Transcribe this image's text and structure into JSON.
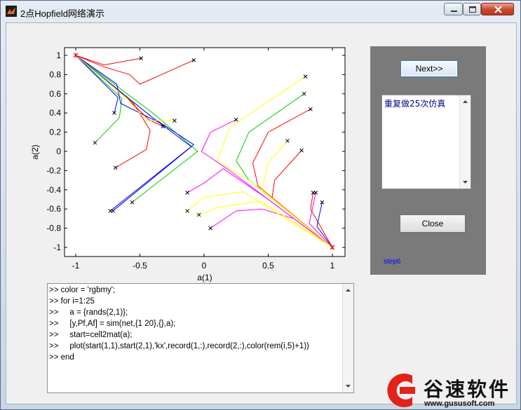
{
  "window": {
    "title": "2点Hopfield网络演示",
    "icon": "matlab-logo-icon",
    "controls": {
      "minimize": "minimize-icon",
      "maximize": "maximize-icon",
      "close": "close-icon"
    }
  },
  "axes": {
    "xlabel": "a(1)",
    "ylabel": "a(2)",
    "xlim": [
      -1.1,
      1.1
    ],
    "ylim": [
      -1.1,
      1.1
    ],
    "xticks": [
      "-1",
      "-0.5",
      "0",
      "0.5",
      "1"
    ],
    "yticks": [
      "1",
      "0.8",
      "0.6",
      "0.4",
      "0.2",
      "0",
      "-0.2",
      "-0.4",
      "-0.6",
      "-0.8",
      "-1"
    ],
    "series_colors": {
      "r": "#ff0000",
      "g": "#00cc00",
      "b": "#0000ff",
      "m": "#ff00ff",
      "y": "#ffff00"
    }
  },
  "chart_data": {
    "type": "line",
    "xlabel": "a(1)",
    "ylabel": "a(2)",
    "xlim": [
      -1.1,
      1.1
    ],
    "ylim": [
      -1.1,
      1.1
    ],
    "grid": false,
    "attractors": [
      [
        -1,
        1
      ],
      [
        1,
        -1
      ]
    ],
    "series": [
      {
        "color": "r",
        "start": [
          -0.08,
          0.95
        ],
        "points": [
          [
            -0.08,
            0.95
          ],
          [
            -0.5,
            0.7
          ],
          [
            -0.58,
            0.8
          ],
          [
            -0.78,
            0.88
          ],
          [
            -1,
            1
          ]
        ]
      },
      {
        "color": "r",
        "start": [
          -0.49,
          0.97
        ],
        "points": [
          [
            -0.49,
            0.97
          ],
          [
            -0.78,
            0.9
          ],
          [
            -1,
            1
          ]
        ]
      },
      {
        "color": "r",
        "start": [
          -0.69,
          -0.17
        ],
        "points": [
          [
            -0.69,
            -0.17
          ],
          [
            -0.45,
            0.02
          ],
          [
            -0.42,
            0.22
          ],
          [
            -0.55,
            0.5
          ],
          [
            -1,
            1
          ]
        ]
      },
      {
        "color": "r",
        "start": [
          -0.32,
          0.26
        ],
        "points": [
          [
            -0.32,
            0.26
          ],
          [
            -0.43,
            0.33
          ],
          [
            -0.6,
            0.55
          ],
          [
            -1,
            1
          ]
        ]
      },
      {
        "color": "r",
        "start": [
          0.83,
          0.44
        ],
        "points": [
          [
            0.83,
            0.44
          ],
          [
            0.5,
            0.2
          ],
          [
            0.38,
            -0.12
          ],
          [
            0.42,
            -0.36
          ],
          [
            1,
            -1
          ]
        ]
      },
      {
        "color": "r",
        "start": [
          0.76,
          0.01
        ],
        "points": [
          [
            0.76,
            0.01
          ],
          [
            0.55,
            -0.3
          ],
          [
            0.53,
            -0.48
          ],
          [
            1,
            -1
          ]
        ]
      },
      {
        "color": "r",
        "start": [
          0.85,
          -0.43
        ],
        "points": [
          [
            0.85,
            -0.43
          ],
          [
            0.83,
            -0.6
          ],
          [
            1,
            -1
          ]
        ]
      },
      {
        "color": "g",
        "start": [
          -0.85,
          0.09
        ],
        "points": [
          [
            -0.85,
            0.09
          ],
          [
            -0.66,
            0.35
          ],
          [
            -0.64,
            0.55
          ],
          [
            -1,
            1
          ]
        ]
      },
      {
        "color": "g",
        "start": [
          -0.56,
          -0.53
        ],
        "points": [
          [
            -0.56,
            -0.53
          ],
          [
            -0.05,
            0.0
          ],
          [
            -0.4,
            0.4
          ],
          [
            -1,
            1
          ]
        ]
      },
      {
        "color": "g",
        "start": [
          0.78,
          0.6
        ],
        "points": [
          [
            0.78,
            0.6
          ],
          [
            0.35,
            0.2
          ],
          [
            0.25,
            -0.1
          ],
          [
            0.35,
            -0.3
          ],
          [
            1,
            -1
          ]
        ]
      },
      {
        "color": "b",
        "start": [
          -0.73,
          -0.62
        ],
        "points": [
          [
            -0.73,
            -0.62
          ],
          [
            -0.1,
            0.05
          ],
          [
            -0.35,
            0.3
          ],
          [
            -0.65,
            0.5
          ],
          [
            -0.68,
            0.7
          ],
          [
            -1,
            1
          ]
        ]
      },
      {
        "color": "b",
        "start": [
          -0.71,
          -0.62
        ],
        "points": [
          [
            -0.71,
            -0.62
          ],
          [
            -0.08,
            0.07
          ],
          [
            -0.4,
            0.35
          ],
          [
            -1,
            1
          ]
        ]
      },
      {
        "color": "b",
        "start": [
          0.92,
          -0.53
        ],
        "points": [
          [
            0.92,
            -0.53
          ],
          [
            0.88,
            -0.78
          ],
          [
            1,
            -1
          ]
        ]
      },
      {
        "color": "b",
        "start": [
          -0.7,
          0.4
        ],
        "points": [
          [
            -0.7,
            0.4
          ],
          [
            -0.67,
            0.56
          ],
          [
            -1,
            1
          ]
        ]
      },
      {
        "color": "m",
        "start": [
          0.25,
          0.33
        ],
        "points": [
          [
            0.25,
            0.33
          ],
          [
            0.05,
            0.2
          ],
          [
            -0.02,
            0.0
          ],
          [
            0.2,
            -0.2
          ],
          [
            1,
            -1
          ]
        ]
      },
      {
        "color": "m",
        "start": [
          -0.13,
          -0.43
        ],
        "points": [
          [
            -0.13,
            -0.43
          ],
          [
            0.0,
            -0.33
          ],
          [
            0.15,
            -0.18
          ],
          [
            0.5,
            -0.5
          ],
          [
            1,
            -1
          ]
        ]
      },
      {
        "color": "m",
        "start": [
          0.05,
          -0.8
        ],
        "points": [
          [
            0.05,
            -0.8
          ],
          [
            0.25,
            -0.62
          ],
          [
            0.45,
            -0.6
          ],
          [
            0.7,
            -0.7
          ],
          [
            1,
            -1
          ]
        ]
      },
      {
        "color": "m",
        "start": [
          0.87,
          -0.43
        ],
        "points": [
          [
            0.87,
            -0.43
          ],
          [
            0.82,
            -0.75
          ],
          [
            1,
            -1
          ]
        ]
      },
      {
        "color": "y",
        "start": [
          0.79,
          0.78
        ],
        "points": [
          [
            0.79,
            0.78
          ],
          [
            0.2,
            0.25
          ],
          [
            0.1,
            -0.1
          ],
          [
            0.35,
            -0.3
          ],
          [
            1,
            -1
          ]
        ]
      },
      {
        "color": "y",
        "start": [
          0.65,
          0.11
        ],
        "points": [
          [
            0.65,
            0.11
          ],
          [
            0.5,
            -0.12
          ],
          [
            0.45,
            -0.4
          ],
          [
            1,
            -1
          ]
        ]
      },
      {
        "color": "y",
        "start": [
          -0.13,
          -0.62
        ],
        "points": [
          [
            -0.13,
            -0.62
          ],
          [
            0.0,
            -0.48
          ],
          [
            0.3,
            -0.42
          ],
          [
            1,
            -1
          ]
        ]
      },
      {
        "color": "y",
        "start": [
          -0.04,
          -0.66
        ],
        "points": [
          [
            -0.04,
            -0.66
          ],
          [
            0.12,
            -0.58
          ],
          [
            0.45,
            -0.52
          ],
          [
            1,
            -1
          ]
        ]
      },
      {
        "color": "y",
        "start": [
          -0.23,
          0.32
        ],
        "points": [
          [
            -0.23,
            0.32
          ],
          [
            -0.45,
            0.32
          ],
          [
            -0.6,
            0.55
          ],
          [
            -1,
            1
          ]
        ]
      }
    ]
  },
  "panel": {
    "next_label": "Next>>",
    "listbox_text": "重复做25次仿真",
    "close_label": "Close",
    "step_label": "step6"
  },
  "console": {
    "lines": [
      ">> color = 'rgbmy';",
      ">> for i=1:25",
      ">>     a = {rands(2,1)};",
      ">>     [y,Pf,Af] = sim(net,{1 20},{},a);",
      ">>     start=cell2mat(a);",
      ">>     plot(start(1,1),start(2,1),'kx',record(1,:),record(2,:),color(rem(i,5)+1))",
      ">> end"
    ]
  },
  "watermark": {
    "text": "谷速软件",
    "url": "www.gususoft.com",
    "logo_icon": "gusu-logo-icon"
  }
}
